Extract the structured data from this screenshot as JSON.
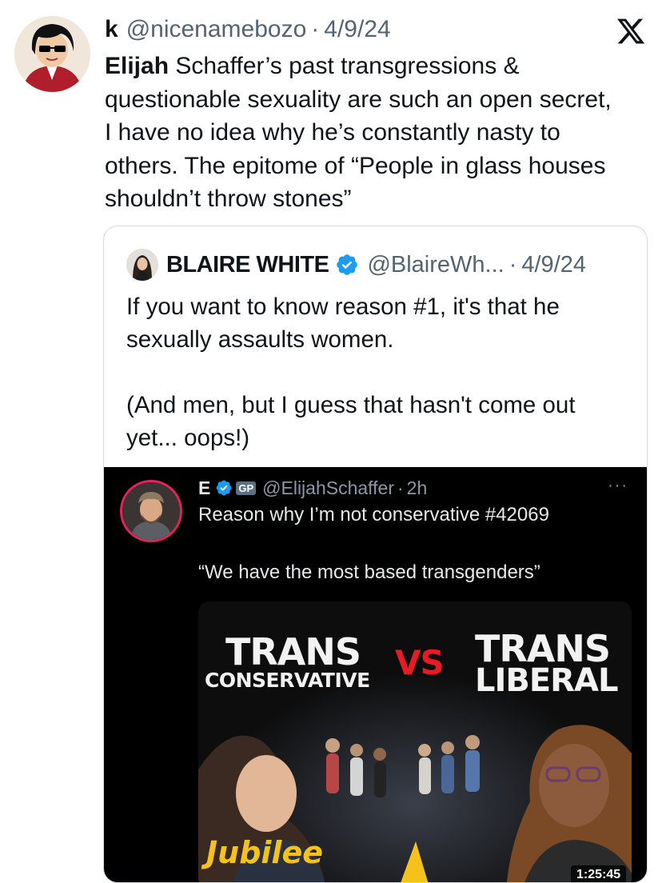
{
  "tweet": {
    "author_name": "k",
    "handle": "@nicenamebozo",
    "date": "4/9/24",
    "separator": "·",
    "text_bold": "Elijah",
    "text_lines": [
      " Schaffer’s past transgressions &",
      "questionable sexuality are such an open secret,",
      "I have no idea why he’s constantly nasty to",
      "others. The epitome of “People in glass houses",
      "shouldn’t throw stones”"
    ]
  },
  "quote": {
    "author_name": "BLAIRE WHITE",
    "handle": "@BlaireWh...",
    "date": "4/9/24",
    "separator": "·",
    "paragraph1": "If you want to know reason #1, it's that he sexually assaults women.",
    "paragraph2": "(And men, but I guess that hasn't come out yet... oops!)"
  },
  "embedded": {
    "author_name": "E",
    "gp_label": "GP",
    "handle": "@ElijahSchaffer",
    "time": "2h",
    "separator": "·",
    "more": "···",
    "line1": "Reason why I’m not conservative #42069",
    "line2": "“We have the most based transgenders”",
    "thumbnail": {
      "trans_left": "TRANS",
      "conservative": "CONSERVATIVE",
      "vs": "VS",
      "trans_right": "TRANS",
      "liberal": "LIBERAL",
      "brand": "Jubilee",
      "duration": "1:25:45"
    }
  },
  "icons": {
    "platform_logo": "x-logo-icon",
    "verified": "verified-badge-icon",
    "more": "more-options-icon"
  },
  "colors": {
    "verified_blue": "#1d9bf0",
    "vs_red": "#e61b23",
    "jubilee_yellow": "#f4c21a",
    "secondary_text": "#536471"
  }
}
